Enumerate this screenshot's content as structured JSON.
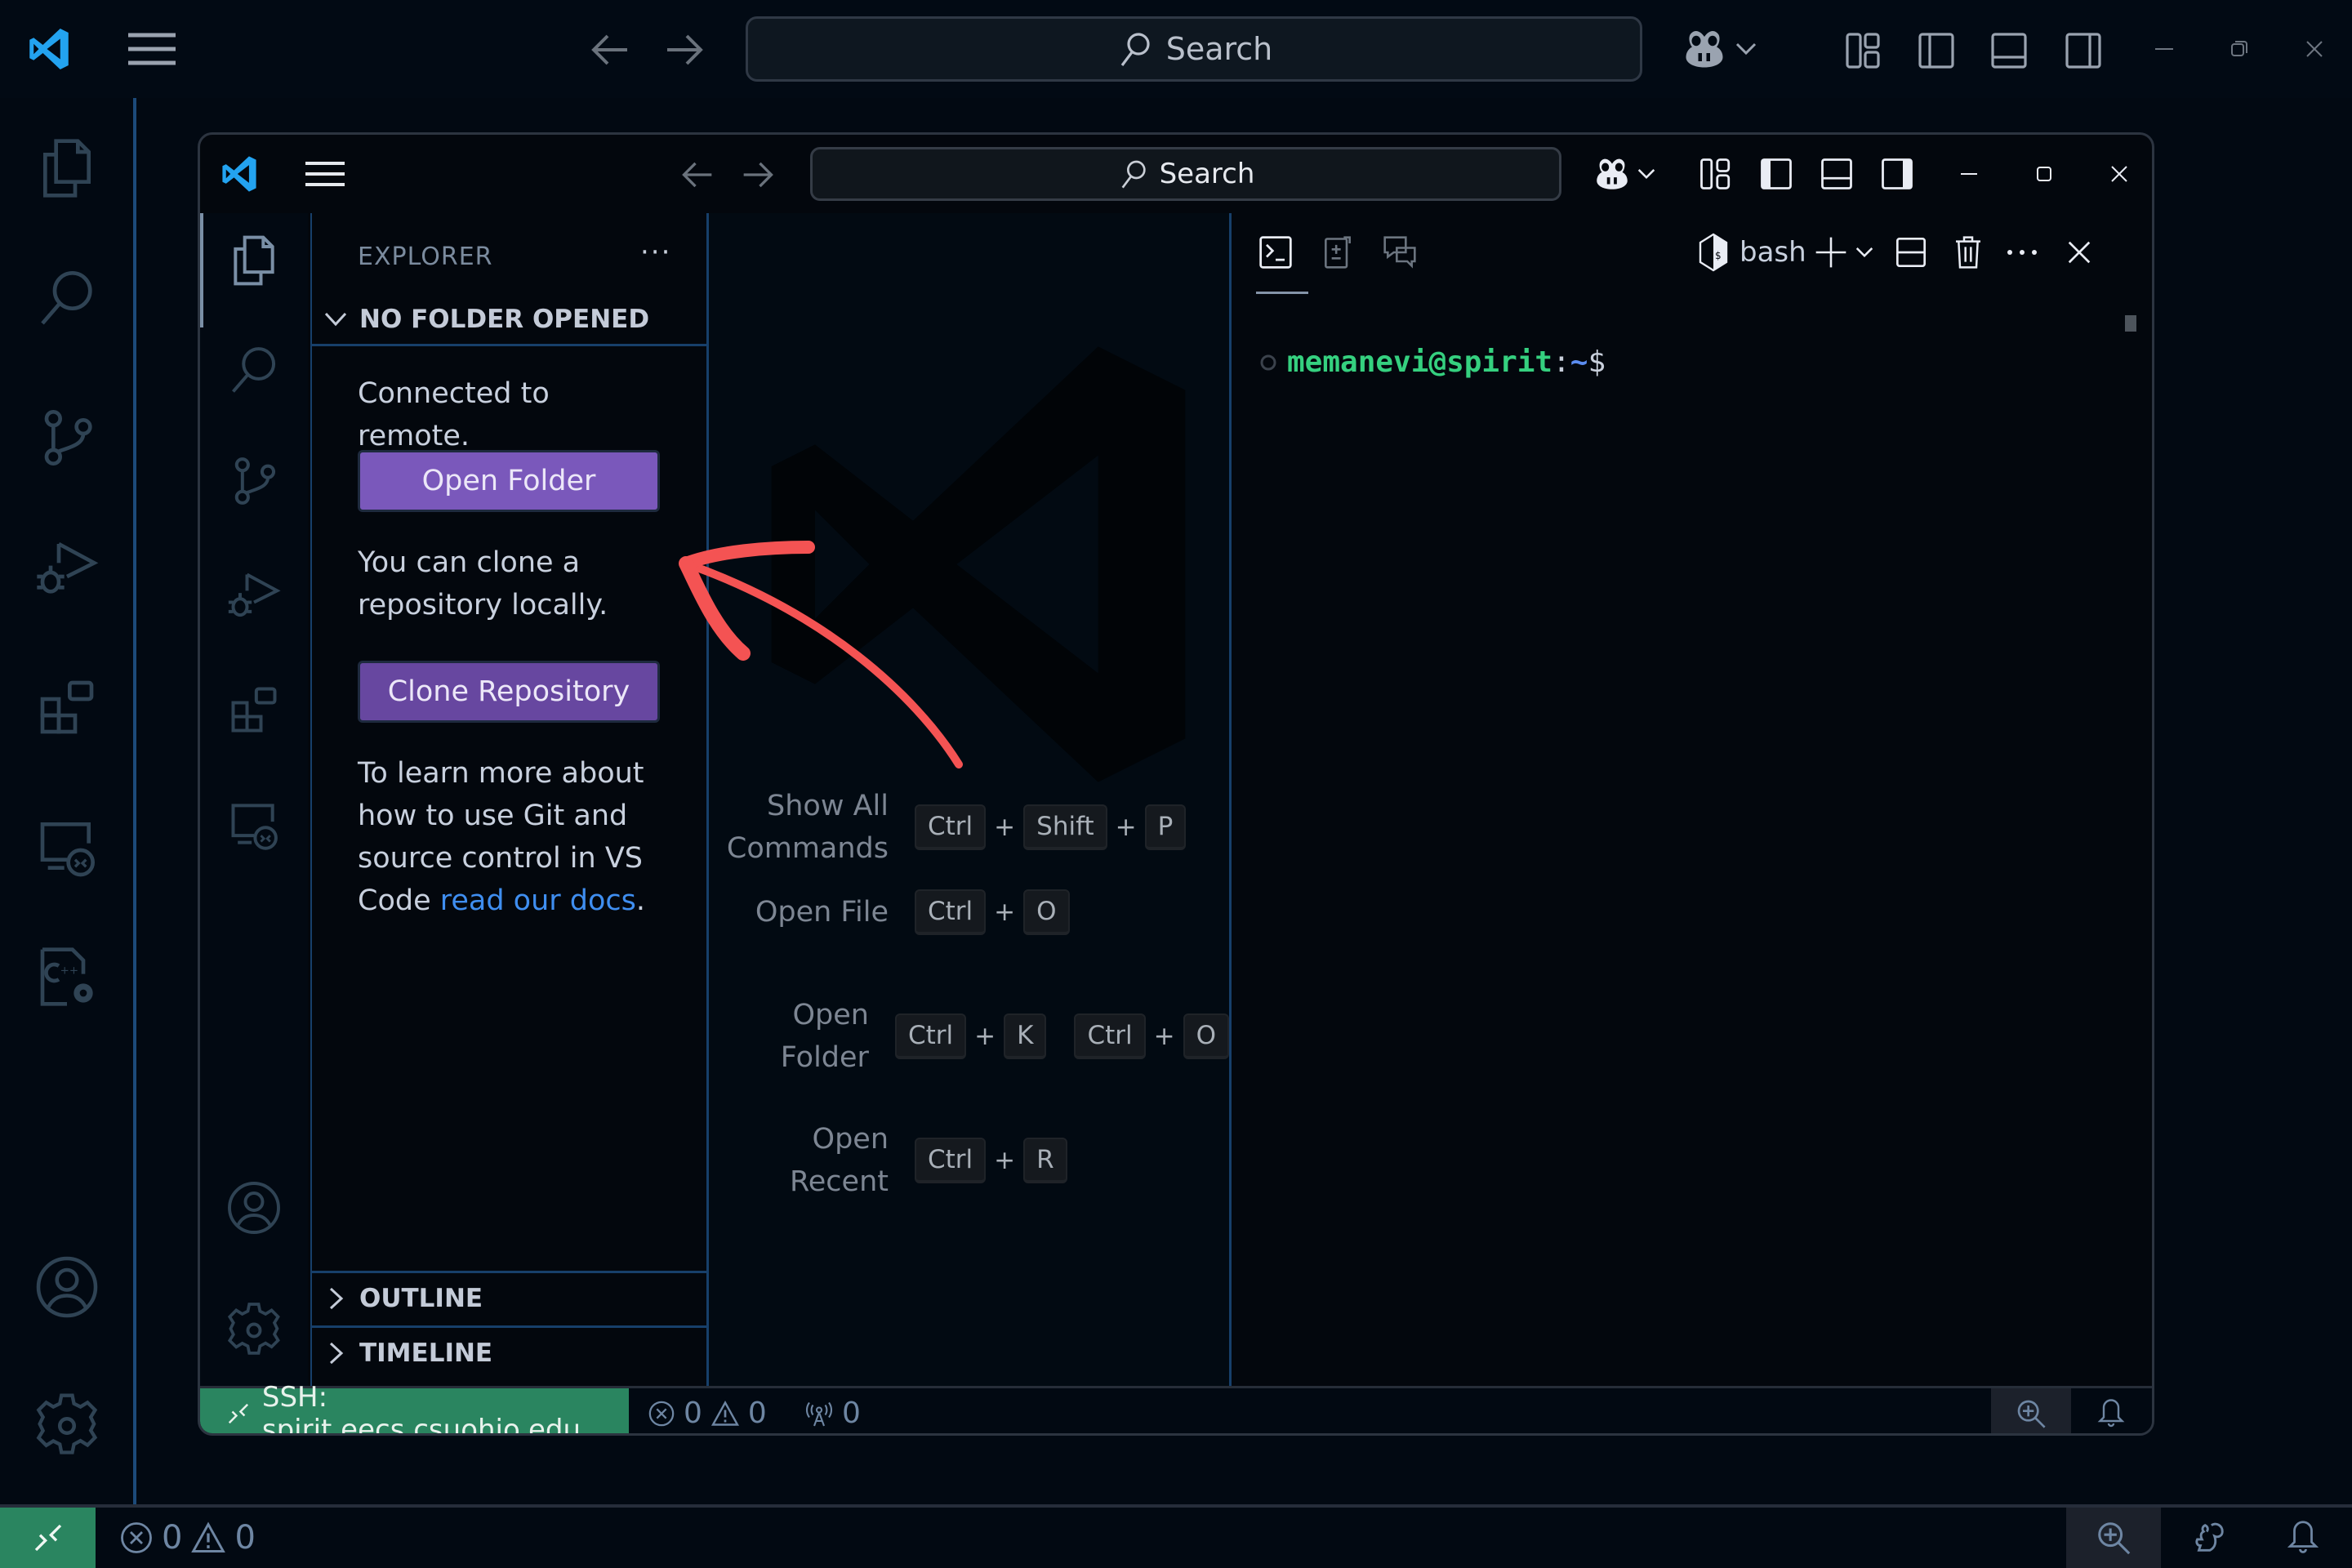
{
  "outer_window": {
    "titlebar": {
      "search_placeholder": "Search",
      "back_label": "Go Back",
      "forward_label": "Go Forward"
    },
    "activity_bar": {
      "items": [
        "Explorer",
        "Search",
        "Source Control",
        "Run and Debug",
        "Extensions",
        "Remote Explorer",
        "C/C++ Configuration"
      ],
      "bottom": [
        "Accounts",
        "Manage"
      ]
    },
    "status_bar": {
      "errors": "0",
      "warnings": "0"
    }
  },
  "inner_window": {
    "titlebar": {
      "search_placeholder": "Search"
    },
    "sidebar": {
      "title": "EXPLORER",
      "more_actions": "···",
      "section_no_folder": "NO FOLDER OPENED",
      "connected_text": "Connected to remote.",
      "open_folder_button": "Open Folder",
      "clone_text": "You can clone a repository locally.",
      "clone_button": "Clone Repository",
      "learn_text_prefix": "To learn more about how to use Git and source control in VS Code ",
      "learn_link": "read our docs",
      "learn_text_suffix": ".",
      "section_outline": "OUTLINE",
      "section_timeline": "TIMELINE"
    },
    "editor": {
      "shortcuts": [
        {
          "label": "Show All Commands",
          "chords": [
            [
              "Ctrl",
              "Shift",
              "P"
            ]
          ]
        },
        {
          "label": "Open File",
          "chords": [
            [
              "Ctrl",
              "O"
            ]
          ]
        },
        {
          "label": "Open Folder",
          "chords": [
            [
              "Ctrl",
              "K"
            ],
            [
              "Ctrl",
              "O"
            ]
          ]
        },
        {
          "label": "Open Recent",
          "chords": [
            [
              "Ctrl",
              "R"
            ]
          ]
        }
      ]
    },
    "panel": {
      "terminal_name": "bash",
      "prompt_user_host": "memanevi@spirit",
      "prompt_colon": ":",
      "prompt_path": "~",
      "prompt_symbol": "$"
    },
    "status_bar": {
      "remote_label": "SSH: spirit.eecs.csuohio.edu",
      "errors": "0",
      "warnings": "0",
      "ports": "0"
    }
  },
  "annotation": {
    "type": "arrow",
    "color": "#f45353",
    "points_to": "Open Folder button"
  },
  "colors": {
    "remote_badge": "#2a8560",
    "primary_button": "#7a58bb",
    "link": "#3f8ef0",
    "prompt_user": "#35d07f",
    "prompt_path": "#5b8cf0",
    "vscode_blue": "#23a3f0"
  }
}
